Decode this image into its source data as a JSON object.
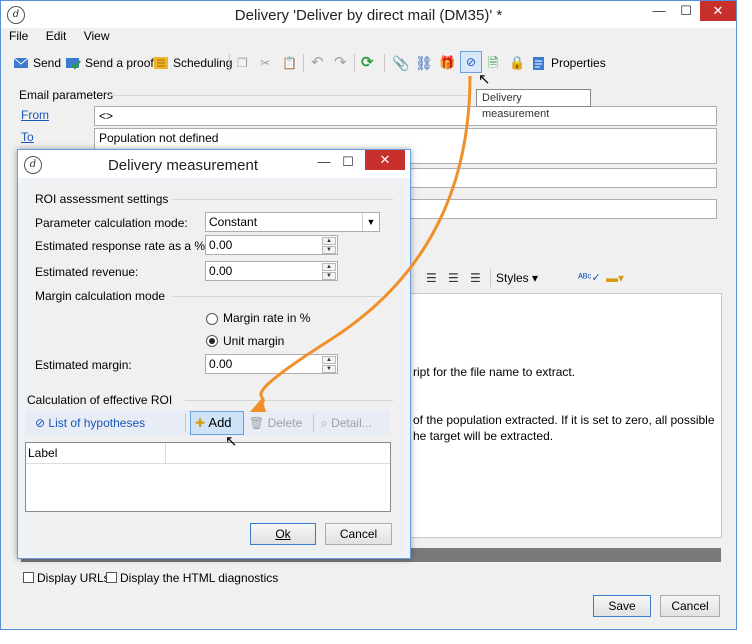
{
  "main_window": {
    "title": "Delivery 'Deliver by direct mail (DM35)' *",
    "controls": {
      "minimize": "—",
      "maximize": "☐",
      "close": "✕"
    }
  },
  "menu": [
    "File",
    "Edit",
    "View"
  ],
  "toolbar": {
    "send": "Send",
    "send_proof": "Send a proof",
    "scheduling": "Scheduling",
    "properties": "Properties"
  },
  "tooltip": "Delivery measurement",
  "email_params": {
    "section_label": "Email parameters",
    "from_label": "From",
    "from_value": "<>",
    "to_label": "To",
    "to_value": "Population not defined"
  },
  "background_text": {
    "line1": "ript for the file name to extract.",
    "line2": "of the population extracted. If it is set to zero, all possible",
    "line3": "he target will be extracted."
  },
  "editor_toolbar": {
    "styles": "Styles"
  },
  "bottom": {
    "display_urls": "Display URLs",
    "display_html_diag": "Display the HTML diagnostics",
    "save": "Save",
    "cancel": "Cancel"
  },
  "dialog": {
    "title": "Delivery measurement",
    "roi_section": "ROI assessment settings",
    "param_calc_label": "Parameter calculation mode:",
    "param_calc_value": "Constant",
    "response_rate_label": "Estimated response rate as a %:",
    "response_rate_value": "0.00",
    "revenue_label": "Estimated revenue:",
    "revenue_value": "0.00",
    "margin_mode_section": "Margin calculation mode",
    "margin_rate_option": "Margin rate in %",
    "unit_margin_option": "Unit margin",
    "selected_margin_mode": "Unit margin",
    "margin_label": "Estimated margin:",
    "margin_value": "0.00",
    "effective_roi_section": "Calculation of effective ROI",
    "list_hypotheses": "List of hypotheses",
    "add": "Add",
    "delete": "Delete",
    "detail": "Detail...",
    "table_header_label": "Label",
    "ok": "Ok",
    "cancel": "Cancel"
  },
  "colors": {
    "accent": "#f0902a",
    "close_red": "#c7302b",
    "link_blue": "#1a55b8"
  }
}
